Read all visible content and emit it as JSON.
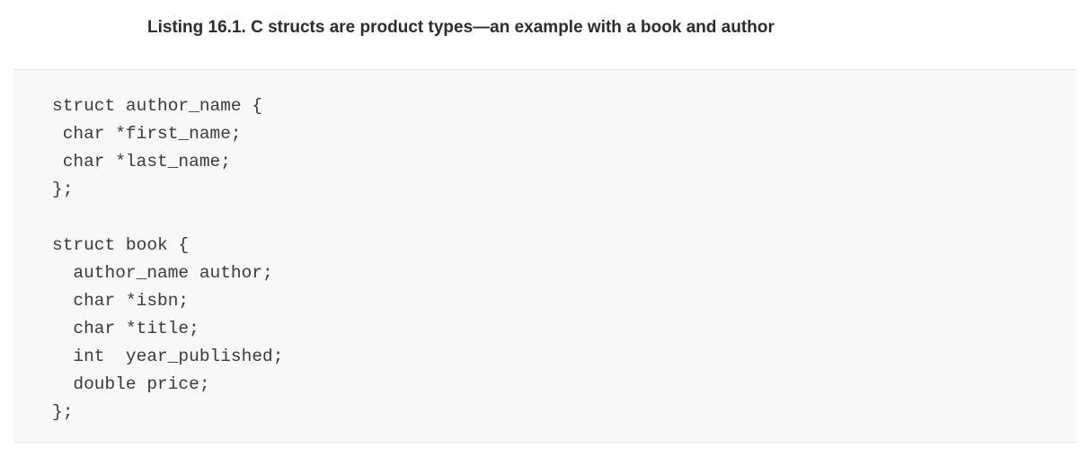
{
  "listing": {
    "title": "Listing 16.1. C structs are product types—an example with a book and author"
  },
  "code": {
    "lines": [
      "struct author_name {",
      " char *first_name;",
      " char *last_name;",
      "};",
      "",
      "struct book {",
      "  author_name author;",
      "  char *isbn;",
      "  char *title;",
      "  int  year_published;",
      "  double price;",
      "};"
    ]
  }
}
